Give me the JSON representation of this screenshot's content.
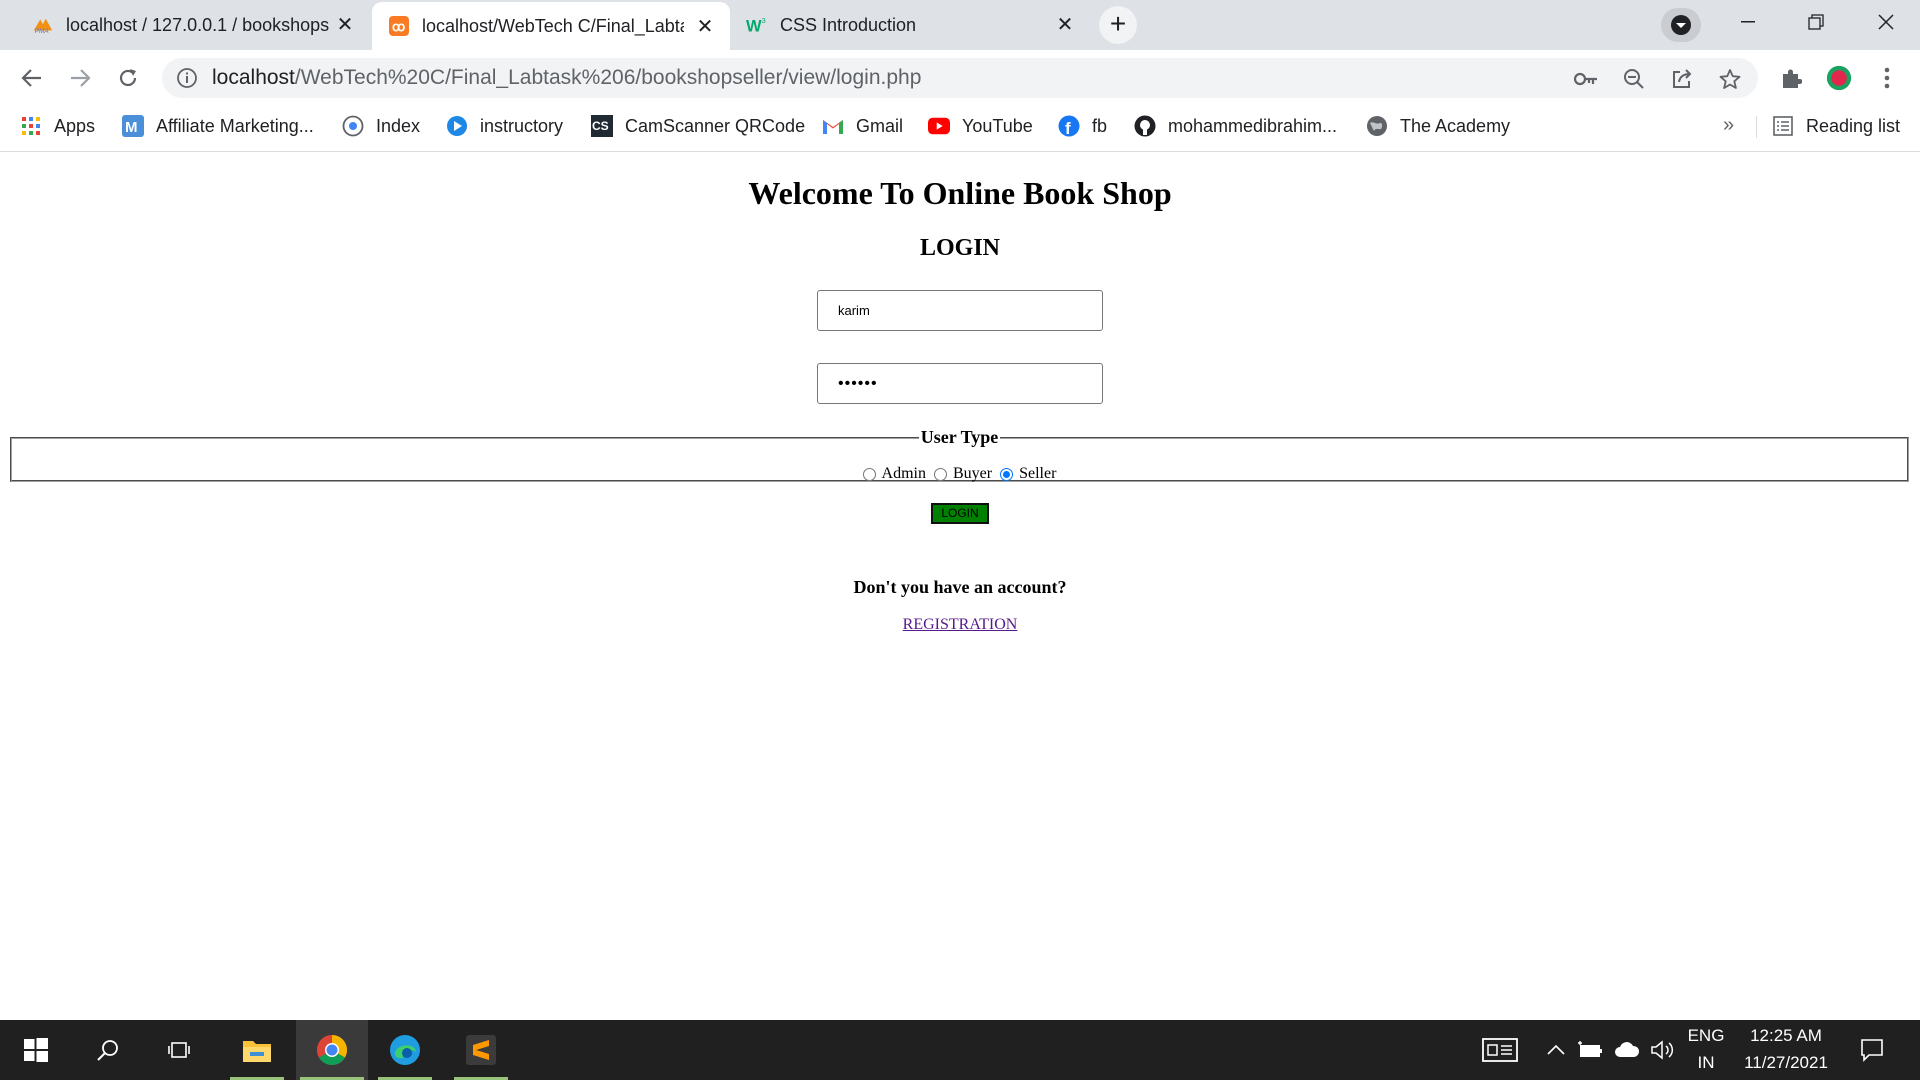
{
  "browser": {
    "tabs": [
      {
        "title": "localhost / 127.0.0.1 / bookshops",
        "icon": "phpmyadmin-icon",
        "active": false
      },
      {
        "title": "localhost/WebTech C/Final_Labta",
        "icon": "xampp-icon",
        "active": true
      },
      {
        "title": "CSS Introduction",
        "icon": "w3schools-icon",
        "active": false
      }
    ],
    "url_host": "localhost",
    "url_path": "/WebTech%20C/Final_Labtask%206/bookshopseller/view/login.php",
    "bookmarks": [
      {
        "label": "Apps",
        "icon": "apps-grid-icon"
      },
      {
        "label": "Affiliate Marketing...",
        "icon": "m-logo-icon"
      },
      {
        "label": "Index",
        "icon": "globe-icon"
      },
      {
        "label": "instructory",
        "icon": "play-icon"
      },
      {
        "label": "CamScanner QRCode",
        "icon": "camscanner-icon"
      },
      {
        "label": "Gmail",
        "icon": "gmail-icon"
      },
      {
        "label": "YouTube",
        "icon": "youtube-icon"
      },
      {
        "label": "fb",
        "icon": "facebook-icon"
      },
      {
        "label": "mohammedibrahim...",
        "icon": "github-icon"
      },
      {
        "label": "The Academy",
        "icon": "globe-icon"
      }
    ],
    "reading_list": "Reading list",
    "more_bookmarks": "»"
  },
  "page": {
    "heading": "Welcome To Online Book Shop",
    "subheading": "LOGIN",
    "username_value": "karim",
    "password_value": "••••••",
    "user_type_legend": "User Type",
    "user_types": [
      {
        "label": "Admin",
        "checked": false
      },
      {
        "label": "Buyer",
        "checked": false
      },
      {
        "label": "Seller",
        "checked": true
      }
    ],
    "login_button": "LOGIN",
    "account_prompt": "Don't you have an account?",
    "registration_link": "REGISTRATION"
  },
  "taskbar": {
    "language": "ENG",
    "region": "IN",
    "time": "12:25 AM",
    "date": "11/27/2021"
  },
  "colors": {
    "login_button_bg": "#008000",
    "link_visited": "#551a8b",
    "tab_bar": "#dee1e6",
    "taskbar": "#202020"
  }
}
